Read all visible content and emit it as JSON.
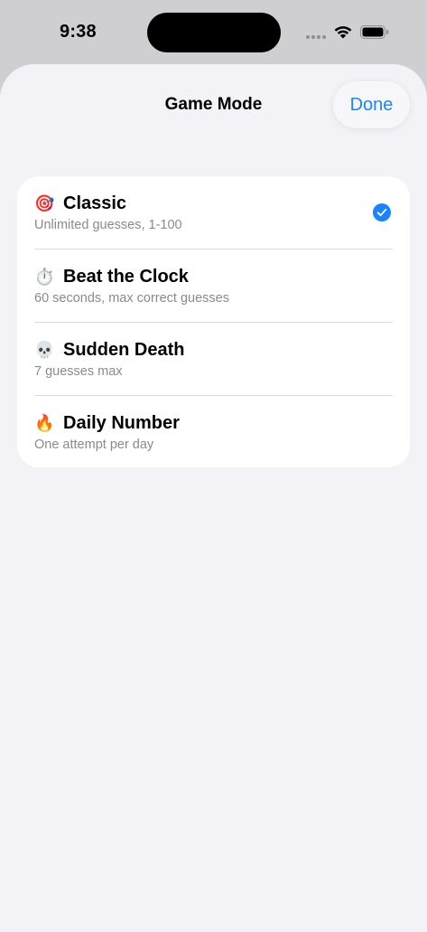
{
  "status_bar": {
    "time": "9:38"
  },
  "sheet": {
    "title": "Game Mode",
    "done_label": "Done",
    "accent_color": "#1a84ff"
  },
  "modes": [
    {
      "emoji": "🎯",
      "icon": "dart-target-icon",
      "title": "Classic",
      "subtitle": "Unlimited guesses, 1-100",
      "selected": true
    },
    {
      "emoji": "⏱️",
      "icon": "stopwatch-icon",
      "title": "Beat the Clock",
      "subtitle": "60 seconds, max correct guesses",
      "selected": false
    },
    {
      "emoji": "💀",
      "icon": "skull-icon",
      "title": "Sudden Death",
      "subtitle": "7 guesses max",
      "selected": false
    },
    {
      "emoji": "🔥",
      "icon": "fire-icon",
      "title": "Daily Number",
      "subtitle": "One attempt per day",
      "selected": false
    }
  ]
}
